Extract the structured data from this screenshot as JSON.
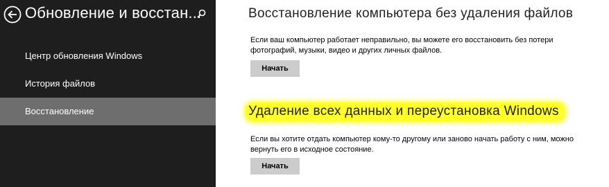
{
  "sidebar": {
    "title": "Обновление и восстан...",
    "items": [
      {
        "label": "Центр обновления Windows",
        "selected": false
      },
      {
        "label": "История файлов",
        "selected": false
      },
      {
        "label": "Восстановление",
        "selected": true
      }
    ]
  },
  "main": {
    "sections": [
      {
        "title": "Восстановление компьютера без удаления файлов",
        "description_line1": "Если ваш компьютер работает неправильно, вы можете его восстановить без потери",
        "description_line2": "фотографий, музыки, видео и других личных файлов.",
        "button_label": "Начать",
        "highlighted": false
      },
      {
        "title": "Удаление всех данных и переустановка Windows",
        "description_line1": "Если вы хотите отдать компьютер кому-то другому или заново начать работу с ним, можно",
        "description_line2": "вернуть его в исходное состояние.",
        "button_label": "Начать",
        "highlighted": true
      }
    ]
  },
  "colors": {
    "sidebar_bg": "#1e1e1e",
    "selected_item_bg": "#6e6e6e",
    "button_bg": "#cccccc",
    "highlight": "#ffff2a"
  },
  "icons": {
    "back": "back-arrow-circle-icon",
    "search": "search-icon"
  }
}
